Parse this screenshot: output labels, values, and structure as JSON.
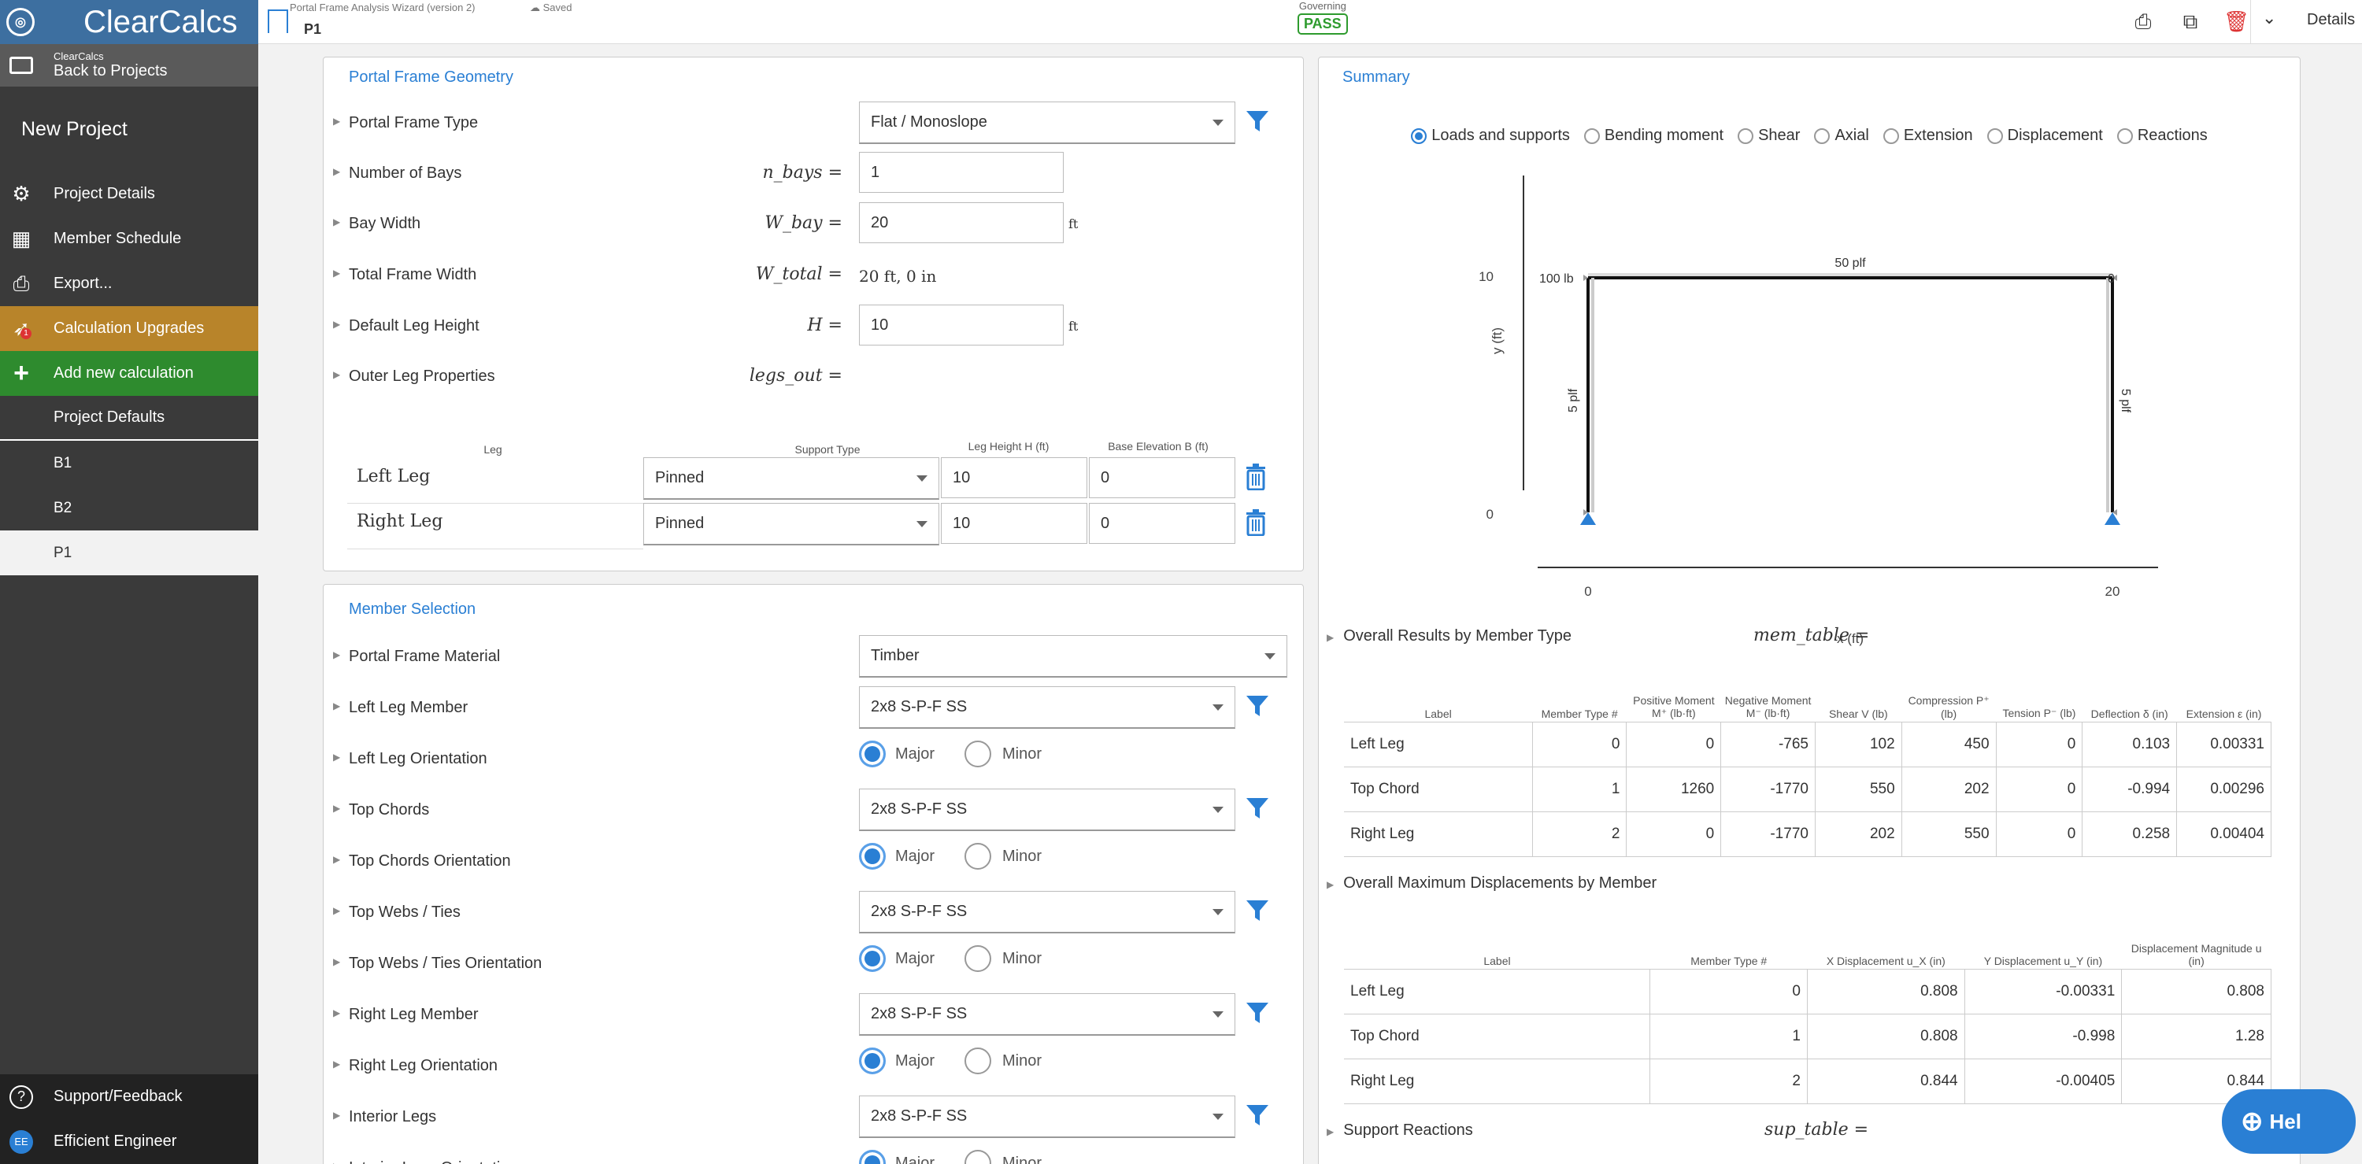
{
  "sidebar": {
    "logo": "ClearCalcs",
    "back_small": "ClearCalcs",
    "back_label": "Back to Projects",
    "project_name": "New Project",
    "items": [
      {
        "label": "Project Details",
        "icon": "gears-icon"
      },
      {
        "label": "Member Schedule",
        "icon": "grid-icon"
      },
      {
        "label": "Export...",
        "icon": "printer-icon"
      },
      {
        "label": "Calculation Upgrades",
        "icon": "rocket-icon"
      },
      {
        "label": "Add new calculation",
        "icon": "plus-icon"
      },
      {
        "label": "Project Defaults"
      }
    ],
    "calcs": [
      "B1",
      "B2",
      "P1"
    ],
    "support": "Support/Feedback",
    "user_initials": "EE",
    "user_name": "Efficient Engineer",
    "upgrade_badge": "1"
  },
  "topbar": {
    "wizard": "Portal Frame Analysis Wizard (version 2)",
    "saved": "Saved",
    "calc_name": "P1",
    "governing_label": "Governing",
    "governing_status": "PASS",
    "details": "Details"
  },
  "geometry": {
    "title": "Portal Frame Geometry",
    "frame_type_label": "Portal Frame Type",
    "frame_type_value": "Flat / Monoslope",
    "bays_label": "Number of Bays",
    "bays_sym": "n_bays =",
    "bays_value": "1",
    "bay_width_label": "Bay Width",
    "bay_width_sym": "W_bay =",
    "bay_width_value": "20",
    "bay_width_unit": "ft",
    "total_width_label": "Total Frame Width",
    "total_width_sym": "W_total =",
    "total_width_value": "20 ft, 0 in",
    "leg_height_label": "Default Leg Height",
    "leg_height_sym": "H =",
    "leg_height_value": "10",
    "leg_height_unit": "ft",
    "outer_legs_label": "Outer Leg Properties",
    "outer_legs_sym": "legs_out =",
    "legs_table": {
      "headers": [
        "Leg",
        "Support Type",
        "Leg Height H (ft)",
        "Base Elevation B (ft)"
      ],
      "rows": [
        {
          "name": "Left Leg",
          "support": "Pinned",
          "height": "10",
          "elev": "0"
        },
        {
          "name": "Right Leg",
          "support": "Pinned",
          "height": "10",
          "elev": "0"
        }
      ]
    }
  },
  "members": {
    "title": "Member Selection",
    "rows": [
      {
        "label": "Portal Frame Material",
        "value": "Timber"
      },
      {
        "label": "Left Leg Member",
        "value": "2x8 S-P-F SS"
      },
      {
        "label": "Left Leg Orientation"
      },
      {
        "label": "Top Chords",
        "value": "2x8 S-P-F SS"
      },
      {
        "label": "Top Chords Orientation"
      },
      {
        "label": "Top Webs / Ties",
        "value": "2x8 S-P-F SS"
      },
      {
        "label": "Top Webs / Ties Orientation"
      },
      {
        "label": "Right Leg Member",
        "value": "2x8 S-P-F SS"
      },
      {
        "label": "Right Leg Orientation"
      },
      {
        "label": "Interior Legs",
        "value": "2x8 S-P-F SS"
      },
      {
        "label": "Interior Legs Orientation"
      }
    ],
    "major": "Major",
    "minor": "Minor"
  },
  "summary": {
    "title": "Summary",
    "view_options": [
      "Loads and supports",
      "Bending moment",
      "Shear",
      "Axial",
      "Extension",
      "Displacement",
      "Reactions"
    ],
    "chart": {
      "xlabel": "x (ft)",
      "ylabel": "y (ft)",
      "xticks": [
        "0",
        "20"
      ],
      "yticks": [
        "10",
        "0"
      ],
      "point_load": "100 lb",
      "top_load": "50 plf",
      "left_load": "5 plf",
      "right_load": "5 plf",
      "end_label": "0"
    },
    "results_title": "Overall Results by Member Type",
    "results_sym": "mem_table =",
    "results_headers": [
      "Label",
      "Member Type #",
      "Positive Moment M⁺ (lb·ft)",
      "Negative Moment M⁻ (lb·ft)",
      "Shear V (lb)",
      "Compression P⁺ (lb)",
      "Tension P⁻ (lb)",
      "Deflection δ (in)",
      "Extension ε (in)"
    ],
    "results_rows": [
      [
        "Left Leg",
        "0",
        "0",
        "-765",
        "102",
        "450",
        "0",
        "0.103",
        "0.00331"
      ],
      [
        "Top Chord",
        "1",
        "1260",
        "-1770",
        "550",
        "202",
        "0",
        "-0.994",
        "0.00296"
      ],
      [
        "Right Leg",
        "2",
        "0",
        "-1770",
        "202",
        "550",
        "0",
        "0.258",
        "0.00404"
      ]
    ],
    "disp_title": "Overall Maximum Displacements by Member",
    "disp_headers": [
      "Label",
      "Member Type #",
      "X Displacement u_X (in)",
      "Y Displacement u_Y (in)",
      "Displacement Magnitude u (in)"
    ],
    "disp_rows": [
      [
        "Left Leg",
        "0",
        "0.808",
        "-0.00331",
        "0.808"
      ],
      [
        "Top Chord",
        "1",
        "0.808",
        "-0.998",
        "1.28"
      ],
      [
        "Right Leg",
        "2",
        "0.844",
        "-0.00405",
        "0.844"
      ]
    ],
    "support_title": "Support Reactions",
    "support_sym": "sup_table =",
    "help": "Hel"
  }
}
